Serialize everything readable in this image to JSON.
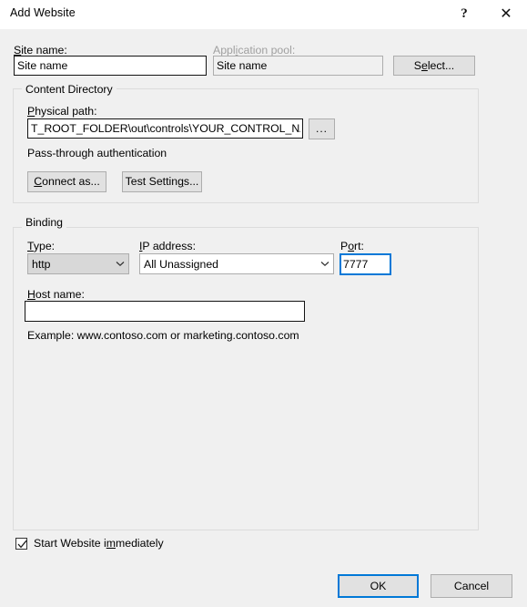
{
  "window": {
    "title": "Add Website",
    "help_icon": "question-mark-icon",
    "close_icon": "close-icon"
  },
  "site_name": {
    "label": "Site name:",
    "label_accel": "S",
    "value": "Site name",
    "placeholder": ""
  },
  "application_pool": {
    "label": "Application pool:",
    "label_accel": "i",
    "value": "Site name",
    "select_button": "Select...",
    "select_accel": "e",
    "disabled": true
  },
  "content_directory": {
    "legend": "Content Directory",
    "physical_path_label": "Physical path:",
    "physical_path_accel": "P",
    "physical_path_value": "T_ROOT_FOLDER\\out\\controls\\YOUR_CONTROL_NAME\\",
    "browse_button": "...",
    "passthrough_text": "Pass-through authentication",
    "connect_as_button": "Connect as...",
    "connect_as_accel": "C",
    "test_settings_button": "Test Settings...",
    "test_settings_accel": "g"
  },
  "binding": {
    "legend": "Binding",
    "type_label": "Type:",
    "type_accel": "T",
    "type_value": "http",
    "type_options": [
      "http"
    ],
    "ip_label": "IP address:",
    "ip_accel": "I",
    "ip_value": "All Unassigned",
    "ip_options": [
      "All Unassigned"
    ],
    "port_label": "Port:",
    "port_accel": "o",
    "port_value": "7777",
    "host_label": "Host name:",
    "host_accel": "H",
    "host_value": "",
    "example_text": "Example: www.contoso.com or marketing.contoso.com"
  },
  "footer": {
    "start_website_label": "Start Website immediately",
    "start_website_accel": "m",
    "start_website_checked": true,
    "ok_button": "OK",
    "cancel_button": "Cancel"
  },
  "colors": {
    "dialog_background": "#f0f0f0",
    "titlebar_background": "#ffffff",
    "accent_blue": "#0078d7",
    "button_face": "#e1e1e1",
    "button_border": "#adadad",
    "disabled_text": "#a0a0a0",
    "group_border": "#dcdcdc"
  }
}
